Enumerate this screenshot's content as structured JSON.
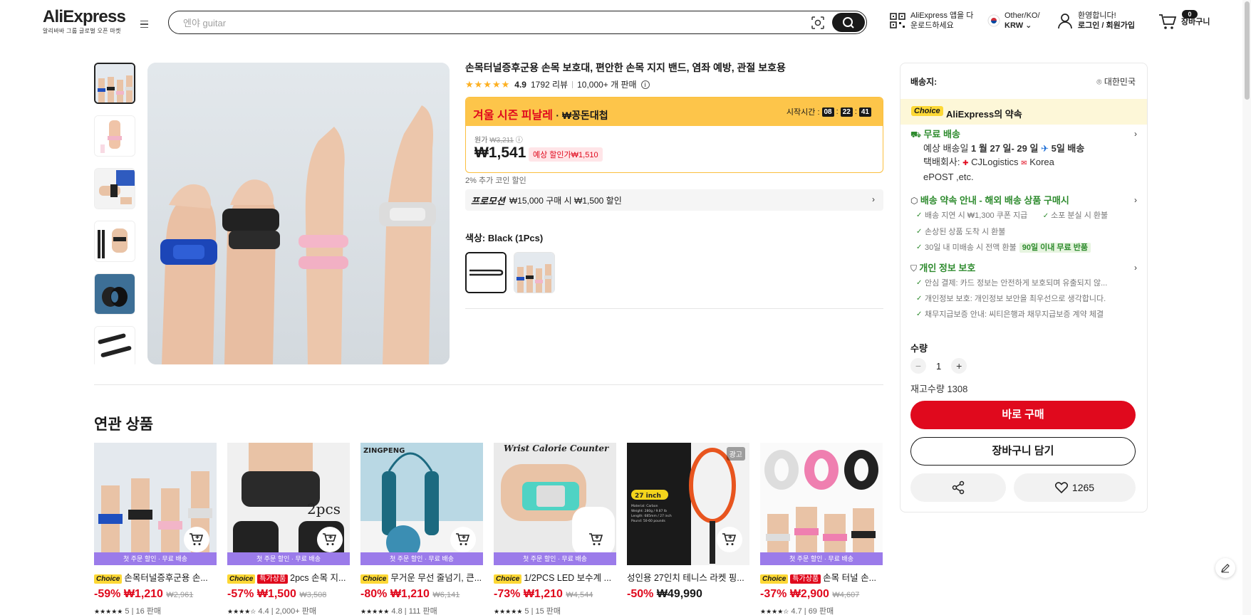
{
  "header": {
    "logo": "AliExpress",
    "logo_sub": "알리바바 그룹 글로벌 오픈 마켓",
    "search_placeholder": "엔야 guitar",
    "app_line1": "AliExpress 앱을 다",
    "app_line2": "운로드하세요",
    "locale_line1": "Other/KO/",
    "locale_line2": "KRW",
    "account_line1": "환영합니다!",
    "account_line2": "로그인 / 회원가입",
    "cart_count": "0",
    "cart_label": "장바구니"
  },
  "product": {
    "title": "손목터널증후군용 손목 보호대, 편안한 손목 지지 밴드, 염좌 예방, 관절 보호용",
    "rating": "4.9",
    "reviews": "1792 리뷰",
    "sold": "10,000+ 개 판매",
    "deal_title": "겨울 시즌 피날레",
    "deal_sub": "· ₩꽁돈대첩",
    "start_label": "시작시간 :",
    "timer": [
      "08",
      "22",
      "41"
    ],
    "orig_label": "원가",
    "orig_price": "₩3,211",
    "price": "₩1,541",
    "est_price": "예상 할인가₩1,510",
    "coin": "2% 추가 코인 할인",
    "promo_label": "프로모션",
    "promo_text": "₩15,000 구매 시 ₩1,500 할인",
    "color_label": "색상: Black (1Pcs)"
  },
  "panel": {
    "ship_to": "배송지:",
    "ship_loc": "대한민국",
    "choice_tag": "Choice",
    "choice_text": "AliExpress의 약속",
    "free_ship": "무료 배송",
    "eta_prefix": "예상 배송일",
    "eta_dates": "1 월 27 일- 29 일",
    "eta_days": "5일 배송",
    "carrier_label": "택배회사:",
    "carrier1": "CJLogistics",
    "carrier2": "Korea",
    "carrier3": "ePOST ,etc.",
    "guarantee_title": "배송 약속 안내 - 해외 배송 상품 구매시",
    "g1": "배송 지연 시 ₩1,300 쿠폰 지급",
    "g2": "소포 분실 시 환불",
    "g3": "손상된 상품 도착 시 환불",
    "g4": "30일 내 미배송 시 전액 환불",
    "g4_tag": "90일 이내 무료 반품",
    "privacy_title": "개인 정보 보호",
    "p1": "안심 결제: 카드 정보는 안전하게 보호되며 유출되지 않...",
    "p2": "개인정보 보호: 개인정보 보안을 최우선으로 생각합니다.",
    "p3": "채무지급보증 안내: 씨티은행과 채무지급보증 계약 체결",
    "qty_label": "수량",
    "qty": "1",
    "stock": "재고수량 1308",
    "buy": "바로 구매",
    "add_cart": "장바구니 담기",
    "likes": "1265"
  },
  "related": {
    "title": "연관 상품",
    "strip": "첫 주문 할인 · 무료 배송",
    "items": [
      {
        "badge": "Choice",
        "hot": "",
        "name": "손목터널증후군용 손...",
        "discount": "-59%",
        "price": "₩1,210",
        "orig": "₩2,961",
        "rating": "5",
        "sold": "16 판매"
      },
      {
        "badge": "Choice",
        "hot": "특가상품",
        "name": "2pcs 손목 지...",
        "discount": "-57%",
        "price": "₩1,500",
        "orig": "₩3,508",
        "rating": "4.4",
        "sold": "2,000+ 판매"
      },
      {
        "badge": "Choice",
        "hot": "",
        "name": "무거운 무선 줄넘기, 큰...",
        "discount": "-80%",
        "price": "₩1,210",
        "orig": "₩6,141",
        "rating": "4.8",
        "sold": "111 판매"
      },
      {
        "badge": "Choice",
        "hot": "",
        "name": "1/2PCS LED 보수계 ...",
        "discount": "-73%",
        "price": "₩1,210",
        "orig": "₩4,544",
        "rating": "5",
        "sold": "15 판매"
      },
      {
        "badge": "",
        "hot": "",
        "name": "성인용 27인치 테니스 라켓 핑...",
        "discount": "-50%",
        "price": "₩49,990",
        "orig": "",
        "rating": "",
        "sold": "",
        "ad": "광고"
      },
      {
        "badge": "Choice",
        "hot": "특가상품",
        "name": "손목 터널 손...",
        "discount": "-37%",
        "price": "₩2,900",
        "orig": "₩4,607",
        "rating": "4.7",
        "sold": "69 판매"
      }
    ],
    "img_text": {
      "c2": "2pcs",
      "c3": "ZINGPENG",
      "c4": "Wrist Calorie Counter",
      "c5_size": "27 inch",
      "c5_spec": "Material: Carbon\nWeight: 280g / 9.87 lb\nLength: 685mm / 27 inch\nPound: 50-60 pounds"
    }
  }
}
